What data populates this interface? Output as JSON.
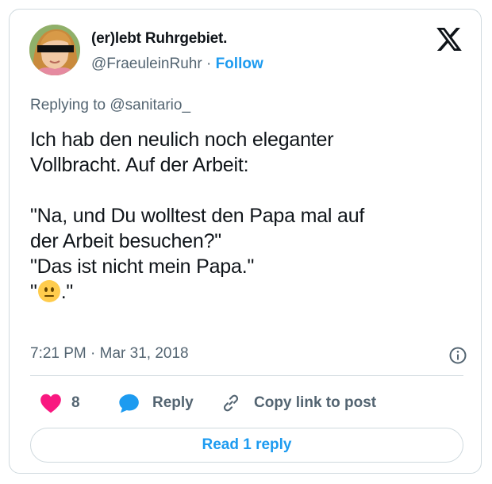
{
  "author": {
    "name": "(er)lebt Ruhrgebiet.",
    "handle": "@FraeuleinRuhr",
    "separator": "·",
    "follow_label": "Follow"
  },
  "reply_context": "Replying to @sanitario_",
  "tweet": {
    "lines": [
      "Ich hab den neulich noch eleganter",
      "Vollbracht. Auf der Arbeit:",
      "",
      "\"Na, und Du wolltest den Papa mal auf",
      "der Arbeit besuchen?\"",
      "\"Das ist nicht mein Papa.\""
    ],
    "last_line_prefix": "\"",
    "last_line_suffix": ".\"",
    "emoji": "neutral-face"
  },
  "meta": {
    "time": "7:21 PM",
    "separator": "·",
    "date": "Mar 31, 2018"
  },
  "actions": {
    "like_count": "8",
    "reply_label": "Reply",
    "copy_link_label": "Copy link to post"
  },
  "read_replies_label": "Read 1 reply",
  "colors": {
    "accent": "#1d9bf0",
    "like": "#f91880",
    "secondary_text": "#536471",
    "border": "#cfd9de"
  }
}
